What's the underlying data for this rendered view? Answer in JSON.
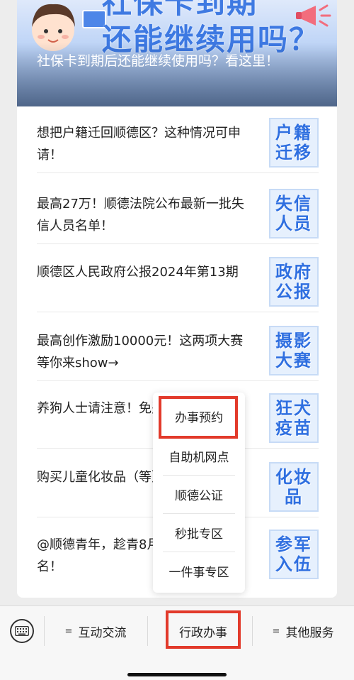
{
  "banner": {
    "art_line1": "社保卡到期",
    "art_line2": "还能继续用吗？",
    "caption": "社保卡到期后还能继续使用吗？看这里！"
  },
  "articles": [
    {
      "title": "想把户籍迁回顺德区？这种情况可申请！",
      "thumb": [
        "户籍",
        "迁移"
      ]
    },
    {
      "title": "最高27万！顺德法院公布最新一批失信人员名单！",
      "thumb": [
        "失信",
        "人员"
      ]
    },
    {
      "title": "顺德区人民政府公报2024年第13期",
      "thumb": [
        "政府",
        "公报"
      ]
    },
    {
      "title": "最高创作激励10000元！这两项大赛等你来show→",
      "thumb": [
        "摄影",
        "大赛"
      ]
    },
    {
      "title": "养狗人士请注意！免费接种！",
      "thumb": [
        "狂犬",
        "疫苗"
      ]
    },
    {
      "title": "购买儿童化妆品（等），认准这个！",
      "thumb": [
        "化妆",
        "品"
      ]
    },
    {
      "title": "@顺德青年，趁青8月10日截止报名！",
      "thumb": [
        "参军",
        "入伍"
      ]
    }
  ],
  "popup_menu": {
    "items": [
      "办事预约",
      "自助机网点",
      "顺德公证",
      "秒批专区",
      "一件事专区"
    ],
    "highlighted_index": 0
  },
  "tabbar": {
    "tabs": [
      "互动交流",
      "行政办事",
      "其他服务"
    ],
    "active_index": 1
  },
  "colors": {
    "highlight": "#e23a2b",
    "thumb_text": "#2f6fe0",
    "background": "#ededed"
  },
  "icons": [
    "keyboard-icon",
    "menu-icon",
    "megaphone-icon",
    "avatar-icon"
  ]
}
